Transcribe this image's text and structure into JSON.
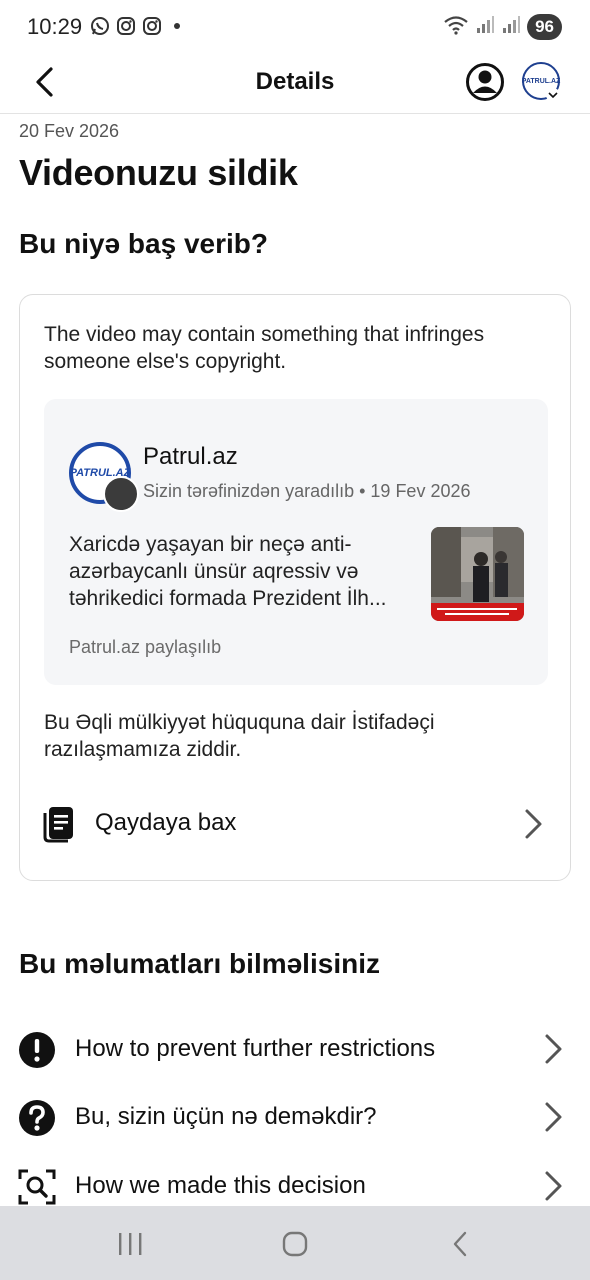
{
  "status_bar": {
    "time": "10:29",
    "battery": "96"
  },
  "header": {
    "title": "Details",
    "avatar_text": "PATRUL.AZ"
  },
  "notice": {
    "date": "20 Fev 2026",
    "title": "Videonuzu sildik"
  },
  "why": {
    "heading": "Bu niyə baş verib?",
    "reason": "The video may contain something that infringes someone else's copyright.",
    "post": {
      "avatar_text": "PATRUL.AZ",
      "author": "Patrul.az",
      "meta": "Sizin tərəfinizdən yaradılıb • 19 Fev 2026",
      "text": "Xaricdə yaşayan bir neçə anti-azərbaycanlı ünsür aqressiv və təhrikedici formada Prezident İlh...",
      "shared_by": "Patrul.az paylaşılıb"
    },
    "policy": "Bu Əqli mülkiyyət hüququna dair İstifadəçi razılaşmamıza ziddir.",
    "rule_link": "Qaydaya bax"
  },
  "know": {
    "heading": "Bu məlumatları bilməlisiniz",
    "items": [
      {
        "label": "How to prevent further restrictions",
        "icon": "exclamation-icon"
      },
      {
        "label": "Bu, sizin üçün nə deməkdir?",
        "icon": "question-icon"
      },
      {
        "label": "How we made this decision",
        "icon": "search-scan-icon"
      }
    ]
  },
  "colors": {
    "brand_blue": "#1f4aa8",
    "nav_bar": "#dcdde1"
  }
}
